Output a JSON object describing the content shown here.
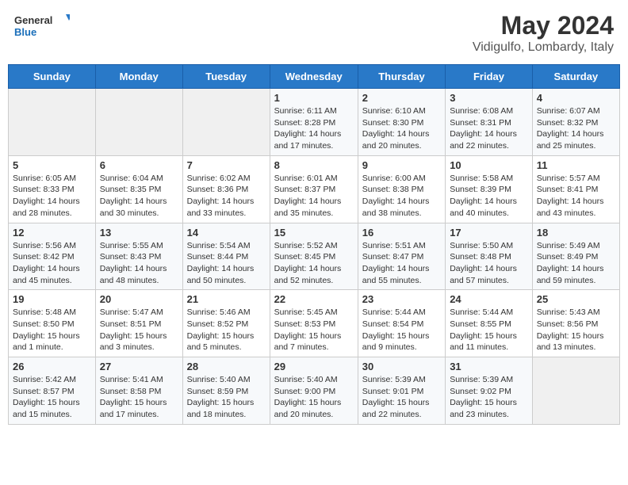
{
  "header": {
    "logo_general": "General",
    "logo_blue": "Blue",
    "month_title": "May 2024",
    "location": "Vidigulfo, Lombardy, Italy"
  },
  "days_of_week": [
    "Sunday",
    "Monday",
    "Tuesday",
    "Wednesday",
    "Thursday",
    "Friday",
    "Saturday"
  ],
  "weeks": [
    {
      "row_class": "row-odd",
      "days": [
        {
          "num": "",
          "empty": true
        },
        {
          "num": "",
          "empty": true
        },
        {
          "num": "",
          "empty": true
        },
        {
          "num": "1",
          "sunrise": "6:11 AM",
          "sunset": "8:28 PM",
          "daylight": "14 hours and 17 minutes."
        },
        {
          "num": "2",
          "sunrise": "6:10 AM",
          "sunset": "8:30 PM",
          "daylight": "14 hours and 20 minutes."
        },
        {
          "num": "3",
          "sunrise": "6:08 AM",
          "sunset": "8:31 PM",
          "daylight": "14 hours and 22 minutes."
        },
        {
          "num": "4",
          "sunrise": "6:07 AM",
          "sunset": "8:32 PM",
          "daylight": "14 hours and 25 minutes."
        }
      ]
    },
    {
      "row_class": "row-even",
      "days": [
        {
          "num": "5",
          "sunrise": "6:05 AM",
          "sunset": "8:33 PM",
          "daylight": "14 hours and 28 minutes."
        },
        {
          "num": "6",
          "sunrise": "6:04 AM",
          "sunset": "8:35 PM",
          "daylight": "14 hours and 30 minutes."
        },
        {
          "num": "7",
          "sunrise": "6:02 AM",
          "sunset": "8:36 PM",
          "daylight": "14 hours and 33 minutes."
        },
        {
          "num": "8",
          "sunrise": "6:01 AM",
          "sunset": "8:37 PM",
          "daylight": "14 hours and 35 minutes."
        },
        {
          "num": "9",
          "sunrise": "6:00 AM",
          "sunset": "8:38 PM",
          "daylight": "14 hours and 38 minutes."
        },
        {
          "num": "10",
          "sunrise": "5:58 AM",
          "sunset": "8:39 PM",
          "daylight": "14 hours and 40 minutes."
        },
        {
          "num": "11",
          "sunrise": "5:57 AM",
          "sunset": "8:41 PM",
          "daylight": "14 hours and 43 minutes."
        }
      ]
    },
    {
      "row_class": "row-odd",
      "days": [
        {
          "num": "12",
          "sunrise": "5:56 AM",
          "sunset": "8:42 PM",
          "daylight": "14 hours and 45 minutes."
        },
        {
          "num": "13",
          "sunrise": "5:55 AM",
          "sunset": "8:43 PM",
          "daylight": "14 hours and 48 minutes."
        },
        {
          "num": "14",
          "sunrise": "5:54 AM",
          "sunset": "8:44 PM",
          "daylight": "14 hours and 50 minutes."
        },
        {
          "num": "15",
          "sunrise": "5:52 AM",
          "sunset": "8:45 PM",
          "daylight": "14 hours and 52 minutes."
        },
        {
          "num": "16",
          "sunrise": "5:51 AM",
          "sunset": "8:47 PM",
          "daylight": "14 hours and 55 minutes."
        },
        {
          "num": "17",
          "sunrise": "5:50 AM",
          "sunset": "8:48 PM",
          "daylight": "14 hours and 57 minutes."
        },
        {
          "num": "18",
          "sunrise": "5:49 AM",
          "sunset": "8:49 PM",
          "daylight": "14 hours and 59 minutes."
        }
      ]
    },
    {
      "row_class": "row-even",
      "days": [
        {
          "num": "19",
          "sunrise": "5:48 AM",
          "sunset": "8:50 PM",
          "daylight": "15 hours and 1 minute."
        },
        {
          "num": "20",
          "sunrise": "5:47 AM",
          "sunset": "8:51 PM",
          "daylight": "15 hours and 3 minutes."
        },
        {
          "num": "21",
          "sunrise": "5:46 AM",
          "sunset": "8:52 PM",
          "daylight": "15 hours and 5 minutes."
        },
        {
          "num": "22",
          "sunrise": "5:45 AM",
          "sunset": "8:53 PM",
          "daylight": "15 hours and 7 minutes."
        },
        {
          "num": "23",
          "sunrise": "5:44 AM",
          "sunset": "8:54 PM",
          "daylight": "15 hours and 9 minutes."
        },
        {
          "num": "24",
          "sunrise": "5:44 AM",
          "sunset": "8:55 PM",
          "daylight": "15 hours and 11 minutes."
        },
        {
          "num": "25",
          "sunrise": "5:43 AM",
          "sunset": "8:56 PM",
          "daylight": "15 hours and 13 minutes."
        }
      ]
    },
    {
      "row_class": "row-odd",
      "days": [
        {
          "num": "26",
          "sunrise": "5:42 AM",
          "sunset": "8:57 PM",
          "daylight": "15 hours and 15 minutes."
        },
        {
          "num": "27",
          "sunrise": "5:41 AM",
          "sunset": "8:58 PM",
          "daylight": "15 hours and 17 minutes."
        },
        {
          "num": "28",
          "sunrise": "5:40 AM",
          "sunset": "8:59 PM",
          "daylight": "15 hours and 18 minutes."
        },
        {
          "num": "29",
          "sunrise": "5:40 AM",
          "sunset": "9:00 PM",
          "daylight": "15 hours and 20 minutes."
        },
        {
          "num": "30",
          "sunrise": "5:39 AM",
          "sunset": "9:01 PM",
          "daylight": "15 hours and 22 minutes."
        },
        {
          "num": "31",
          "sunrise": "5:39 AM",
          "sunset": "9:02 PM",
          "daylight": "15 hours and 23 minutes."
        },
        {
          "num": "",
          "empty": true
        }
      ]
    }
  ],
  "labels": {
    "sunrise": "Sunrise:",
    "sunset": "Sunset:",
    "daylight": "Daylight:"
  }
}
